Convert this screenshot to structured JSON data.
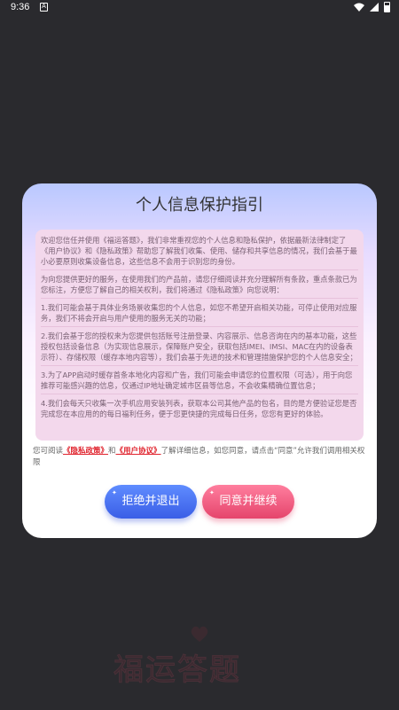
{
  "status_bar": {
    "time": "9:36",
    "notif": "A"
  },
  "dialog": {
    "title": "个人信息保护指引",
    "paragraphs": [
      "欢迎您信任并使用《福运答题》，我们非常重视您的个人信息和隐私保护，依据最新法律制定了《用户协议》和《隐私政策》帮助您了解我们收集、使用、储存和共享信息的情况，我们会基于最小必要原则收集设备信息，这些信息不会用于识别您的身份。",
      "为向您提供更好的服务，在使用我们的产品前，请您仔细阅读并充分理解所有条款，重点条款已为您标注，方便您了解自己的相关权利，我们将通过《隐私政策》向您说明：",
      "1.我们可能会基于具体业务场景收集您的个人信息，如您不希望开启相关功能，可停止使用对应服务，我们不将会开启与用户使用的服务无关的功能；",
      "2.我们会基于您的授权来为您提供包括账号注册登录、内容展示、信息咨询在内的基本功能，这些授权包括设备信息（为实现信息展示，保障账户安全，获取包括IMEI、IMSI、MAC在内的设备表示符）、存储权限（缓存本地内容等），我们会基于先进的技术和管理措施保护您的个人信息安全；",
      "3.为了APP启动时缓存首条本地化内容和广告，我们可能会申请您的位置权限（可选），用于向您推荐可能感兴趣的信息，仅通过IP地址确定城市区县等信息，不会收集精确位置信息；",
      "4.我们会每天只收集一次手机应用安装列表，获取本公司其他产品的包名，目的是方便验证您是否完成您在本应用的的每日福利任务，便于您更快捷的完成每日任务，您您有更好的体验。"
    ],
    "consent": {
      "prefix": "您可阅读",
      "privacy_link": "《隐私政策》",
      "and": "和",
      "user_link": "《用户协议》",
      "suffix": "了解详细信息，如您同意，请点击“同意”允许我们调用相关权限"
    },
    "reject_label": "拒绝并退出",
    "agree_label": "同意并继续"
  },
  "background": {
    "logo_text": "福运答题"
  },
  "colors": {
    "reject": "#3a5ee6",
    "agree": "#e5456c",
    "link": "#e0242e"
  }
}
